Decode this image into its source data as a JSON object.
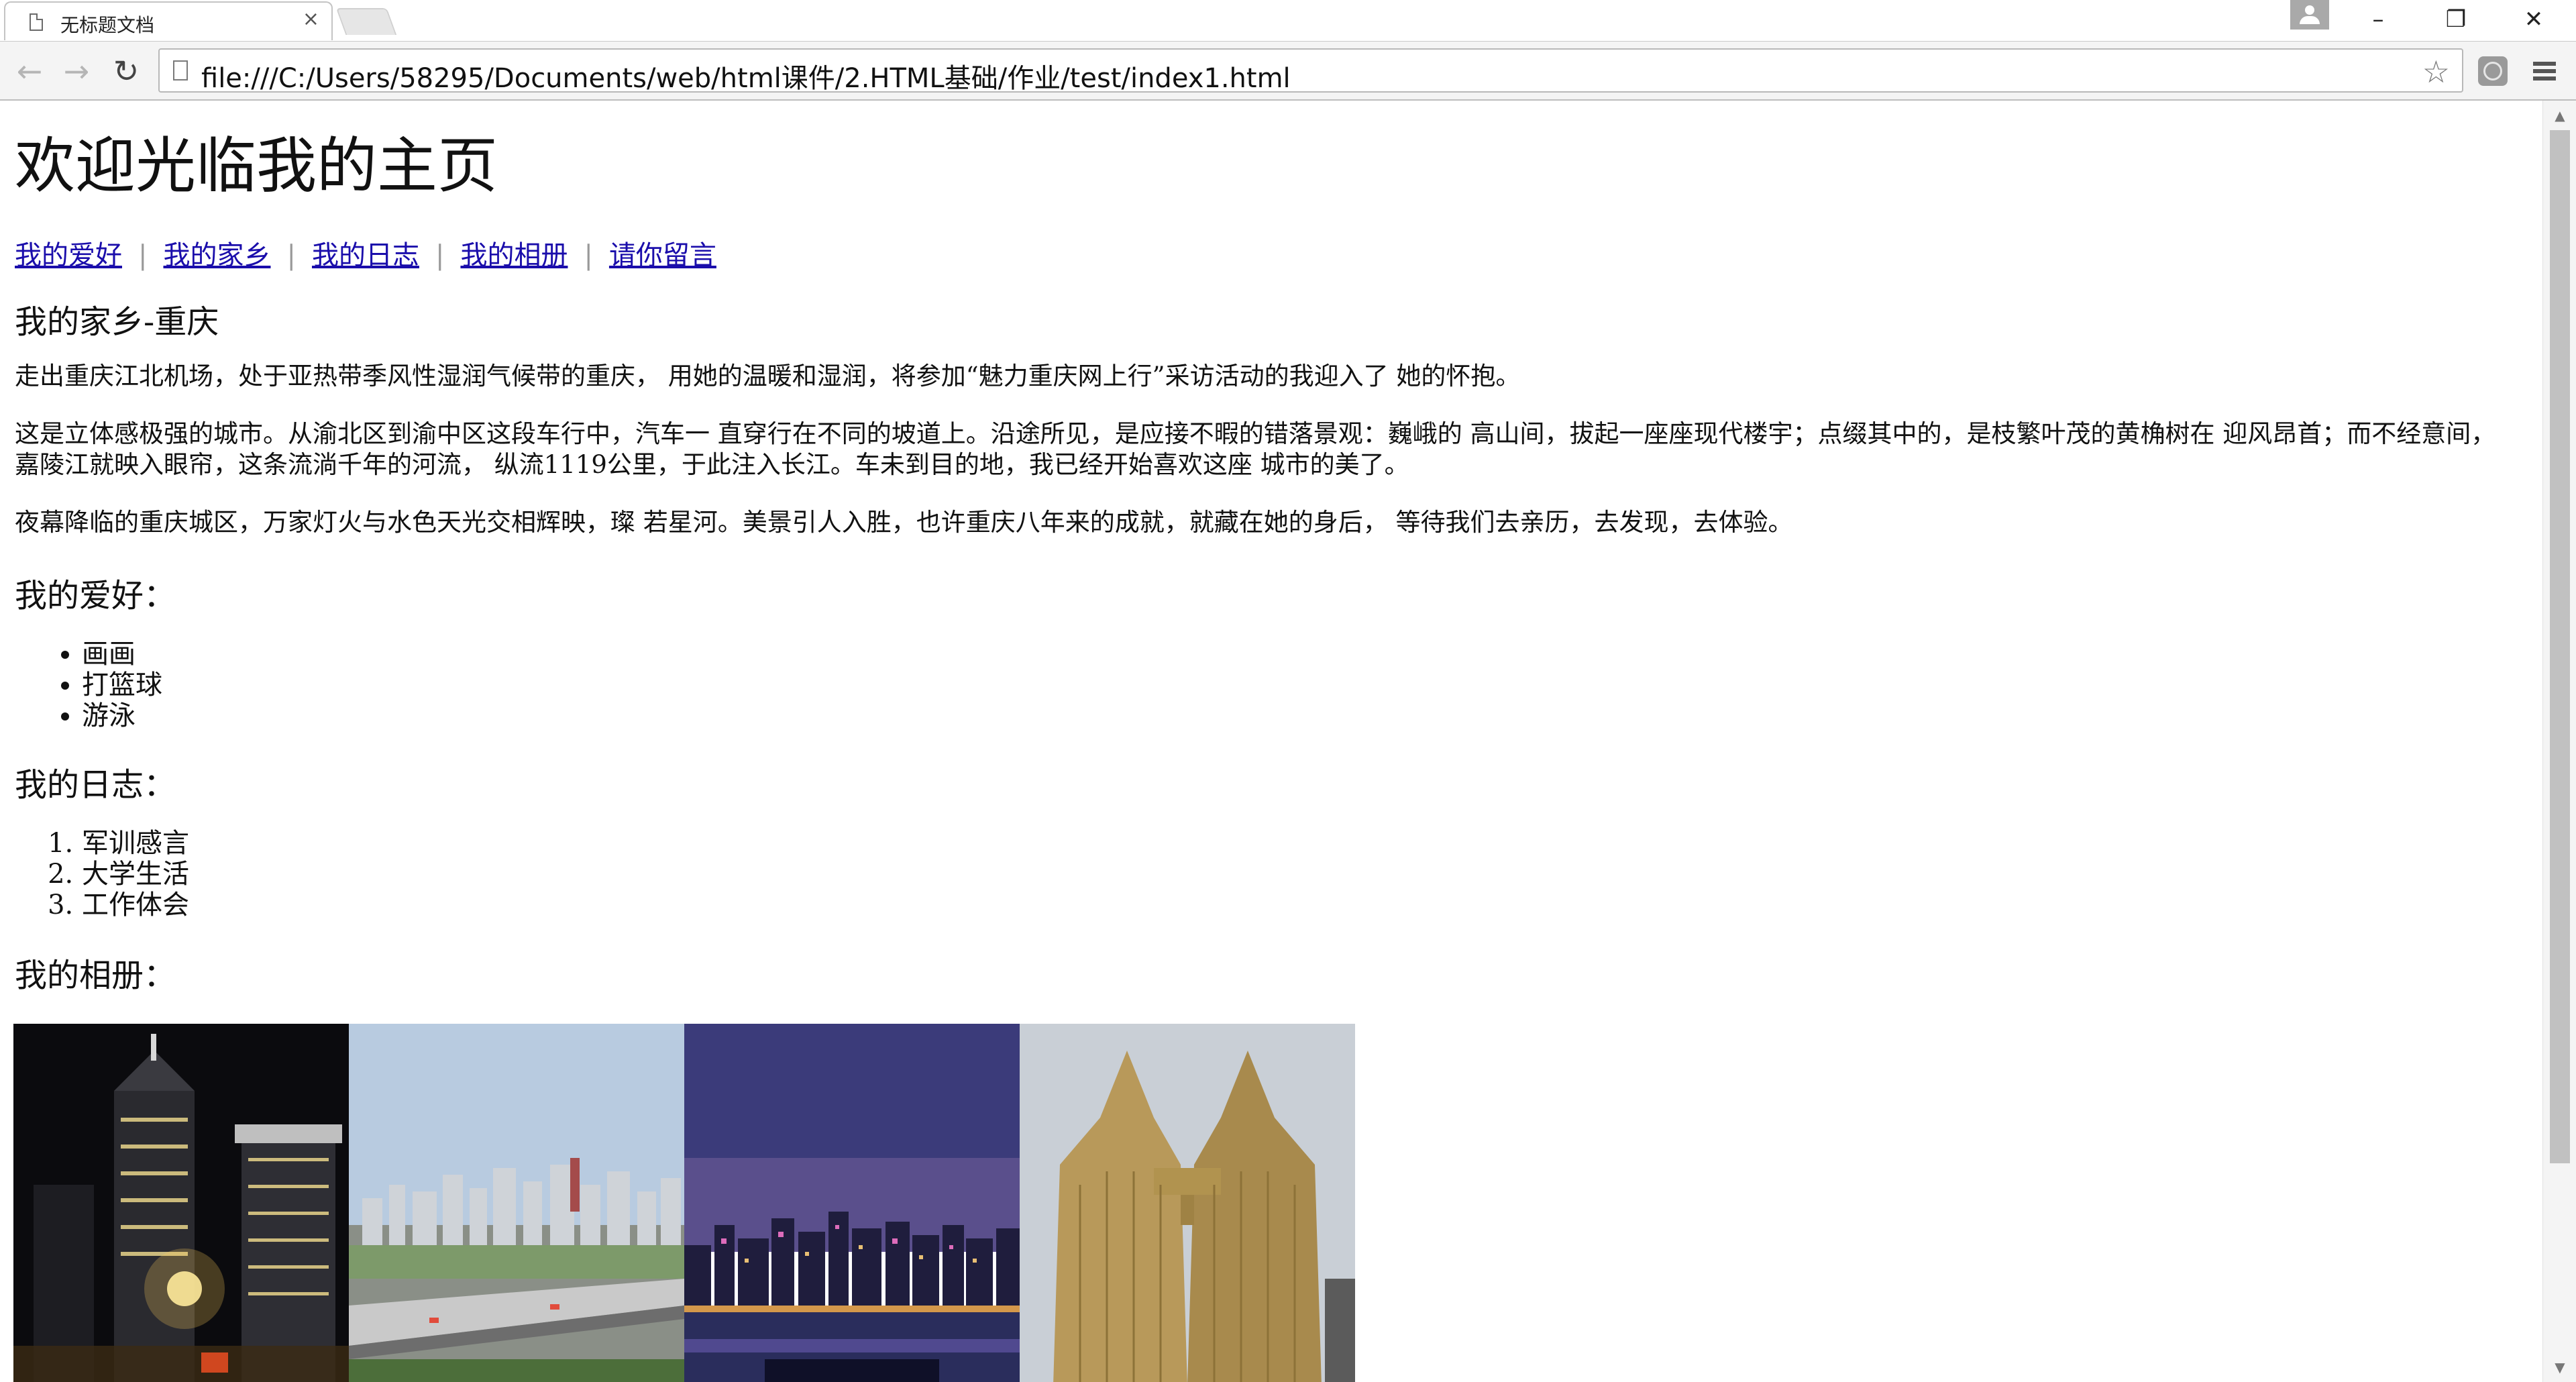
{
  "browser": {
    "tab_title": "无标题文档",
    "tab_close": "×",
    "url": "file:///C:/Users/58295/Documents/web/html课件/2.HTML基础/作业/test/index1.html",
    "back_icon": "←",
    "forward_icon": "→",
    "reload_icon": "↻",
    "star_icon": "☆",
    "minimize_icon": "–",
    "restore_icon": "❐",
    "close_icon": "✕"
  },
  "page": {
    "title": "欢迎光临我的主页",
    "nav": [
      "我的爱好",
      "我的家乡",
      "我的日志",
      "我的相册",
      "请你留言"
    ],
    "hometown": {
      "heading": "我的家乡-重庆",
      "paragraphs": [
        "走出重庆江北机场，处于亚热带季风性湿润气候带的重庆， 用她的温暖和湿润，将参加“魅力重庆网上行”采访活动的我迎入了 她的怀抱。",
        "这是立体感极强的城市。从渝北区到渝中区这段车行中，汽车一 直穿行在不同的坡道上。沿途所见，是应接不暇的错落景观：巍峨的 高山间，拔起一座座现代楼宇；点缀其中的，是枝繁叶茂的黄桷树在 迎风昂首；而不经意间，嘉陵江就映入眼帘，这条流淌千年的河流， 纵流1119公里，于此注入长江。车未到目的地，我已经开始喜欢这座 城市的美了。",
        "夜幕降临的重庆城区，万家灯火与水色天光交相辉映，璨 若星河。美景引人入胜，也许重庆八年来的成就，就藏在她的身后， 等待我们去亲历，去发现，去体验。"
      ]
    },
    "hobbies": {
      "heading": "我的爱好：",
      "items": [
        "画画",
        "打篮球",
        "游泳"
      ]
    },
    "diary": {
      "heading": "我的日志：",
      "items": [
        "军训感言",
        "大学生活",
        "工作体会"
      ]
    },
    "album": {
      "heading": "我的相册："
    }
  }
}
